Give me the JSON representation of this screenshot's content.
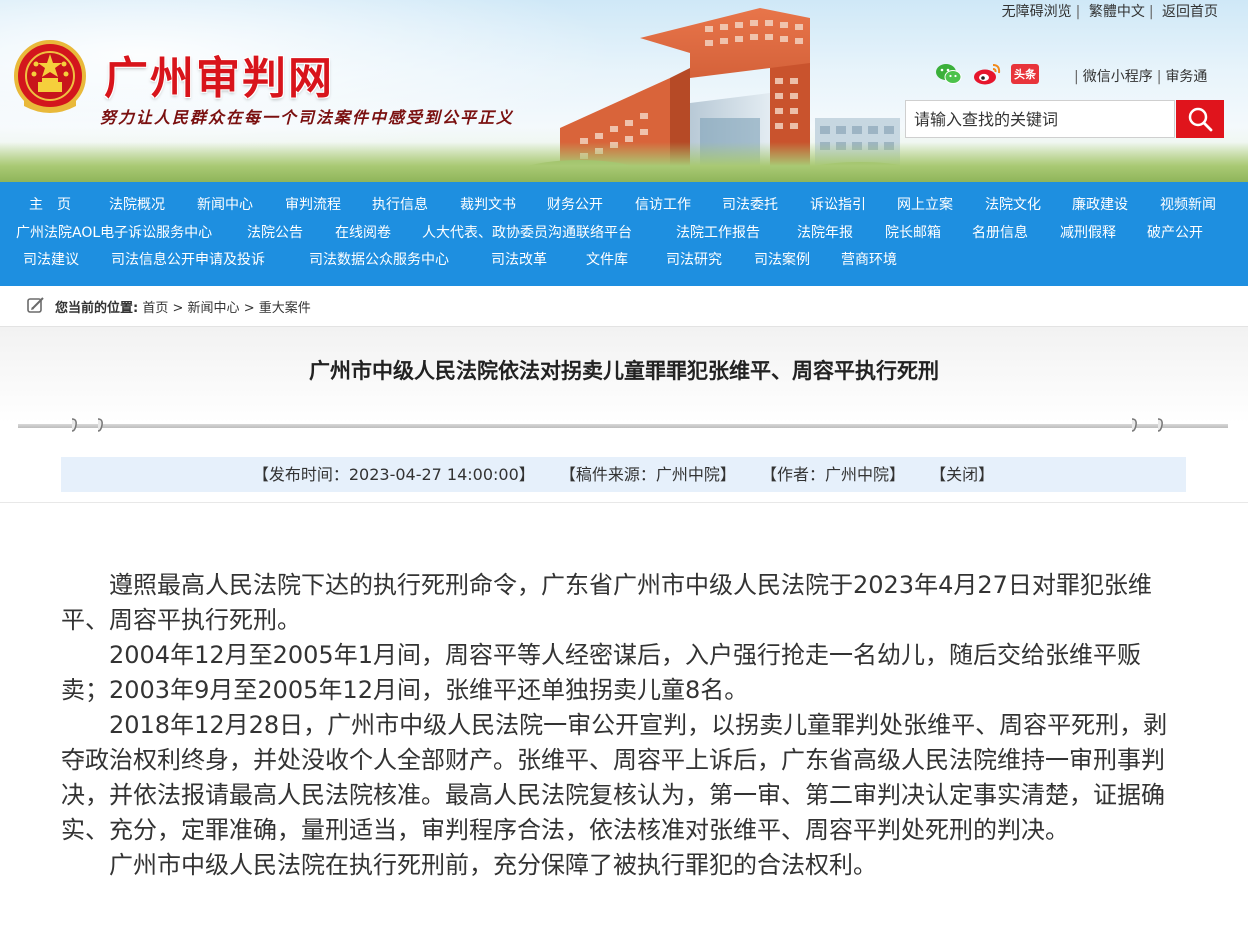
{
  "header": {
    "site_title": "广州审判网",
    "slogan": "努力让人民群众在每一个司法案件中感受到公平正义",
    "top_links": [
      "无障碍浏览",
      "繁體中文",
      "返回首页"
    ],
    "mini_links": [
      "微信小程序",
      "审务通"
    ],
    "social_icons": [
      "wechat-icon",
      "weibo-icon",
      "toutiao-icon"
    ],
    "toutiao_label": "头条",
    "search_placeholder": "请输入查找的关键词",
    "accent_color": "#d8141b"
  },
  "nav": {
    "color": "#1e8fe0",
    "row1": [
      "主　页",
      "法院概况",
      "新闻中心",
      "审判流程",
      "执行信息",
      "裁判文书",
      "财务公开",
      "信访工作",
      "司法委托",
      "诉讼指引",
      "网上立案",
      "法院文化",
      "廉政建设",
      "视频新闻"
    ],
    "row2": [
      "广州法院AOL电子诉讼服务中心",
      "法院公告",
      "在线阅卷",
      "人大代表、政协委员沟通联络平台",
      "法院工作报告",
      "法院年报",
      "院长邮箱",
      "名册信息",
      "减刑假释",
      "破产公开"
    ],
    "row3": [
      "司法建议",
      "司法信息公开申请及投诉",
      "司法数据公众服务中心",
      "司法改革",
      "文件库",
      "司法研究",
      "司法案例",
      "营商环境"
    ]
  },
  "breadcrumb": {
    "label": "您当前的位置:",
    "items": [
      "首页",
      "新闻中心",
      "重大案件"
    ],
    "sep": ">"
  },
  "article": {
    "title": "广州市中级人民法院依法对拐卖儿童罪罪犯张维平、周容平执行死刑",
    "meta": {
      "publish_time": "【发布时间：2023-04-27 14:00:00】",
      "source": "【稿件来源：广州中院】",
      "author": "【作者：广州中院】",
      "close": "【关闭】"
    },
    "paragraphs": [
      "遵照最高人民法院下达的执行死刑命令，广东省广州市中级人民法院于2023年4月27日对罪犯张维平、周容平执行死刑。",
      "2004年12月至2005年1月间，周容平等人经密谋后，入户强行抢走一名幼儿，随后交给张维平贩卖；2003年9月至2005年12月间，张维平还单独拐卖儿童8名。",
      "2018年12月28日，广州市中级人民法院一审公开宣判，以拐卖儿童罪判处张维平、周容平死刑，剥夺政治权利终身，并处没收个人全部财产。张维平、周容平上诉后，广东省高级人民法院维持一审刑事判决，并依法报请最高人民法院核准。最高人民法院复核认为，第一审、第二审判决认定事实清楚，证据确实、充分，定罪准确，量刑适当，审判程序合法，依法核准对张维平、周容平判处死刑的判决。",
      "广州市中级人民法院在执行死刑前，充分保障了被执行罪犯的合法权利。"
    ]
  }
}
